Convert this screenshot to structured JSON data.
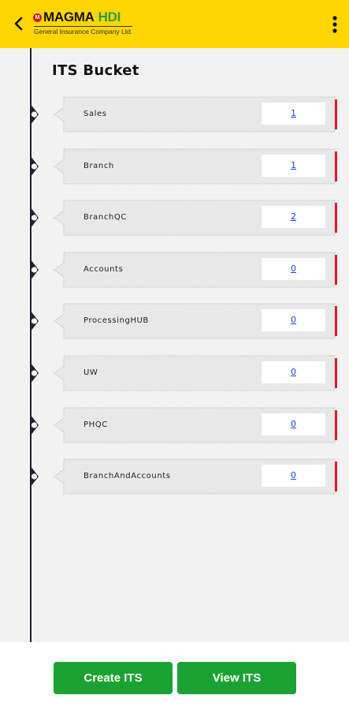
{
  "header": {
    "logo_badge": "M",
    "logo_word1": "MAGMA",
    "logo_word2": "HDI",
    "logo_subtitle": "General Insurance Company Ltd.",
    "background_color": "#ffd600",
    "back_icon": "chevron-left-icon",
    "menu_icon": "more-vertical-icon"
  },
  "page": {
    "title": "ITS Bucket"
  },
  "buckets": [
    {
      "label": "Sales",
      "count": "1"
    },
    {
      "label": "Branch",
      "count": "1"
    },
    {
      "label": "BranchQC",
      "count": "2"
    },
    {
      "label": "Accounts",
      "count": "0"
    },
    {
      "label": "ProcessingHUB",
      "count": "0"
    },
    {
      "label": "UW",
      "count": "0"
    },
    {
      "label": "PHQC",
      "count": "0"
    },
    {
      "label": "BranchAndAccounts",
      "count": "0"
    }
  ],
  "actions": {
    "create_label": "Create ITS",
    "view_label": "View ITS",
    "button_color": "#1aa333",
    "accent_red": "#e01c2a"
  }
}
